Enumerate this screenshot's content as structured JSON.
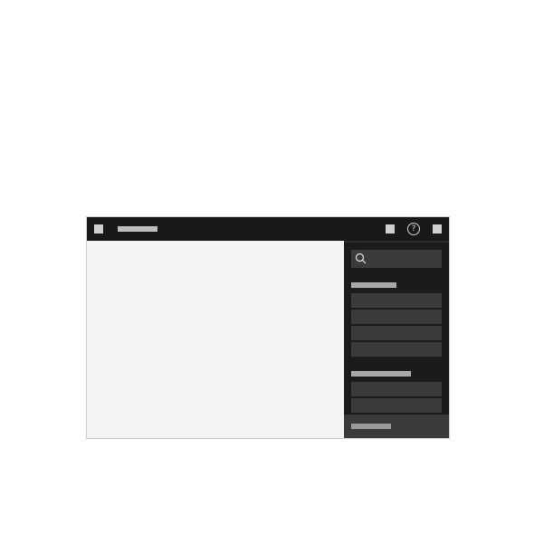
{
  "topbar": {
    "left_icon": "square-icon",
    "title": "",
    "right_icons": [
      "square-icon",
      "help-icon",
      "square-icon"
    ],
    "help_glyph": "?"
  },
  "panel": {
    "search": {
      "icon": "search-icon",
      "placeholder": ""
    },
    "sections": [
      {
        "heading": "",
        "items": [
          "",
          "",
          "",
          ""
        ]
      },
      {
        "heading": "",
        "items": [
          "",
          ""
        ]
      }
    ],
    "footer_label": ""
  },
  "colors": {
    "topbar_bg": "#191919",
    "panel_bg": "#1b1b1b",
    "item_bg": "#3b3b3b",
    "canvas_bg": "#f3f3f3"
  }
}
